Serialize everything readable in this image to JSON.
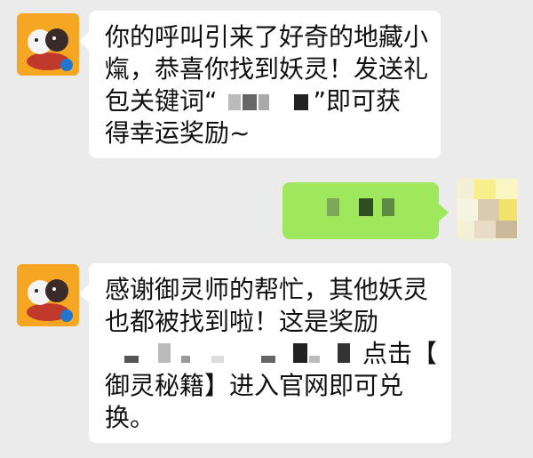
{
  "messages": [
    {
      "sender": "other",
      "lines": [
        "你的呼叫引来了好奇的地藏小",
        "熂，恭喜你找到妖灵！发送礼",
        "包关键词“",
        "”即可获",
        "得幸运奖励~"
      ]
    },
    {
      "sender": "self",
      "content": "redacted"
    },
    {
      "sender": "other",
      "lines": [
        "感谢御灵师的帮忙，其他妖灵",
        "也都被找到啦！这是奖励",
        "点击【",
        "御灵秘籍】进入官网即可兑",
        "换。"
      ]
    }
  ],
  "colors": {
    "background": "#ebebeb",
    "incoming_bubble": "#ffffff",
    "outgoing_bubble": "#9fe85e",
    "avatar_bg": "#f5a623"
  }
}
